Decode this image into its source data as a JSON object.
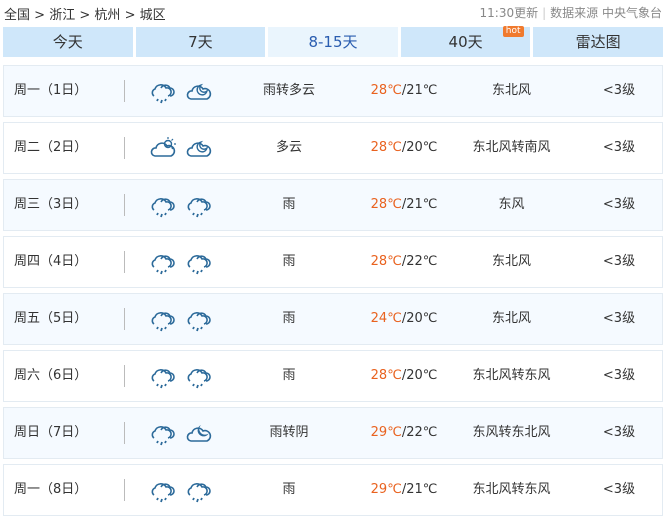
{
  "breadcrumb": [
    "全国",
    "浙江",
    "杭州",
    "城区"
  ],
  "breadcrumb_sep": ">",
  "update_time": "11:30更新",
  "source": "数据来源 中央气象台",
  "tabs": [
    {
      "label": "今天"
    },
    {
      "label": "7天"
    },
    {
      "label": "8-15天"
    },
    {
      "label": "40天",
      "badge": "hot"
    },
    {
      "label": "雷达图"
    }
  ],
  "active_tab": "8-15天",
  "rows": [
    {
      "day": "周一（1日）",
      "icons": [
        "rain",
        "cloudy-night"
      ],
      "desc": "雨转多云",
      "high": "28℃",
      "low": "/21℃",
      "wind": "东北风",
      "level": "<3级"
    },
    {
      "day": "周二（2日）",
      "icons": [
        "cloudy-day",
        "cloudy-night"
      ],
      "desc": "多云",
      "high": "28℃",
      "low": "/20℃",
      "wind": "东北风转南风",
      "level": "<3级"
    },
    {
      "day": "周三（3日）",
      "icons": [
        "rain",
        "rain"
      ],
      "desc": "雨",
      "high": "28℃",
      "low": "/21℃",
      "wind": "东风",
      "level": "<3级"
    },
    {
      "day": "周四（4日）",
      "icons": [
        "rain",
        "rain"
      ],
      "desc": "雨",
      "high": "28℃",
      "low": "/22℃",
      "wind": "东北风",
      "level": "<3级"
    },
    {
      "day": "周五（5日）",
      "icons": [
        "rain",
        "rain"
      ],
      "desc": "雨",
      "high": "24℃",
      "low": "/20℃",
      "wind": "东北风",
      "level": "<3级"
    },
    {
      "day": "周六（6日）",
      "icons": [
        "rain",
        "rain"
      ],
      "desc": "雨",
      "high": "28℃",
      "low": "/20℃",
      "wind": "东北风转东风",
      "level": "<3级"
    },
    {
      "day": "周日（7日）",
      "icons": [
        "rain",
        "overcast-night"
      ],
      "desc": "雨转阴",
      "high": "29℃",
      "low": "/22℃",
      "wind": "东风转东北风",
      "level": "<3级"
    },
    {
      "day": "周一（8日）",
      "icons": [
        "rain",
        "rain"
      ],
      "desc": "雨",
      "high": "29℃",
      "low": "/21℃",
      "wind": "东北风转东风",
      "level": "<3级"
    }
  ],
  "colors": {
    "accent": "#e9621f",
    "tab_bg": "#cfe7fa",
    "tab_active": "#eaf5fd",
    "icon": "#2c6a9a"
  }
}
